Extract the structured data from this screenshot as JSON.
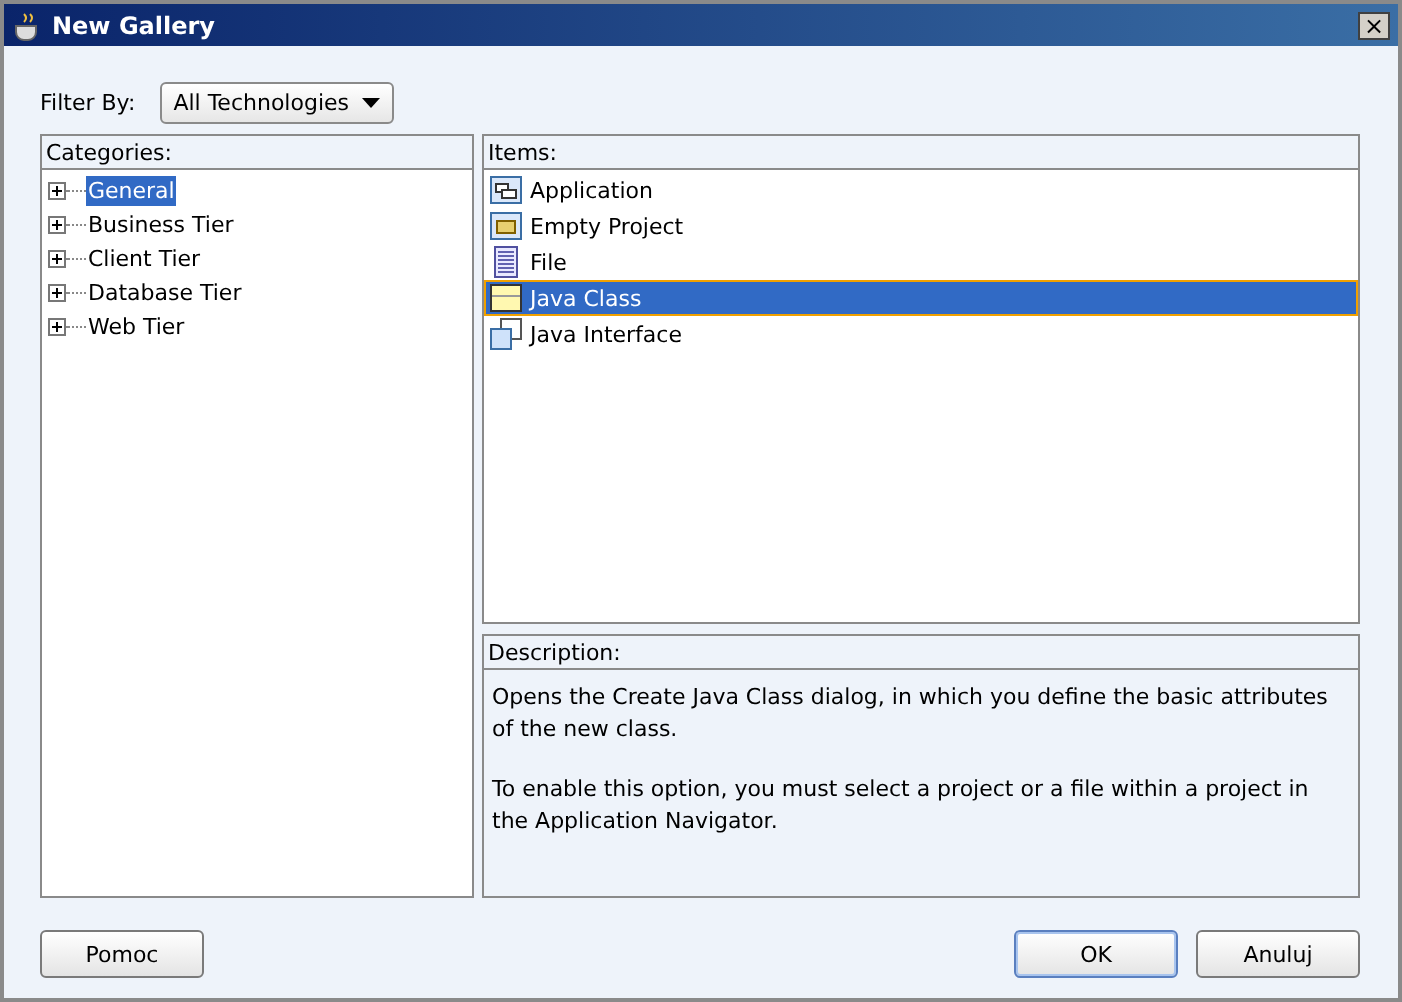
{
  "window": {
    "title": "New Gallery",
    "close": "×"
  },
  "filter": {
    "label": "Filter By:",
    "value": "All Technologies"
  },
  "categories": {
    "header": "Categories:",
    "items": [
      {
        "label": "General",
        "selected": true,
        "expanded": false
      },
      {
        "label": "Business Tier",
        "selected": false,
        "expanded": false
      },
      {
        "label": "Client Tier",
        "selected": false,
        "expanded": false
      },
      {
        "label": "Database Tier",
        "selected": false,
        "expanded": false
      },
      {
        "label": "Web Tier",
        "selected": false,
        "expanded": false
      }
    ]
  },
  "items": {
    "header": "Items:",
    "list": [
      {
        "label": "Application",
        "kind": "application",
        "selected": false
      },
      {
        "label": "Empty Project",
        "kind": "project",
        "selected": false
      },
      {
        "label": "File",
        "kind": "file",
        "selected": false
      },
      {
        "label": "Java Class",
        "kind": "class",
        "selected": true
      },
      {
        "label": "Java Interface",
        "kind": "interface",
        "selected": false
      }
    ]
  },
  "description": {
    "header": "Description:",
    "paragraphs": [
      "Opens the Create Java Class dialog, in which you define the basic attributes of the new class.",
      "To enable this option, you must select a project or a file within a project in the Application Navigator."
    ]
  },
  "buttons": [
    {
      "label": "Pomoc",
      "default": false
    },
    {
      "label": "OK",
      "default": true
    },
    {
      "label": "Anuluj",
      "default": false
    }
  ]
}
